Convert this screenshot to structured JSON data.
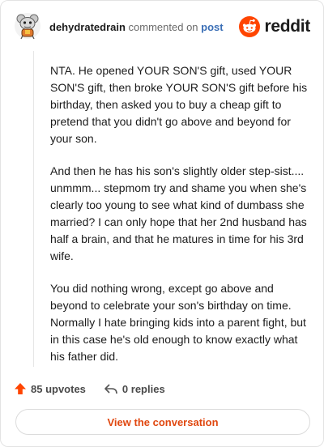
{
  "header": {
    "username": "dehydratedrain",
    "action_text": "commented on",
    "post_link": "post",
    "brand": "reddit"
  },
  "comment": {
    "paragraphs": [
      "NTA. He opened YOUR SON'S gift, used YOUR SON'S gift, then broke YOUR SON'S gift before his birthday, then asked you to buy a cheap gift to pretend that you didn't go above and beyond for your son.",
      "And then he has his son's slightly older step-sist.... unmmm... stepmom try and shame you when she's clearly too young to see what kind of dumbass she married? I can only hope that her 2nd husband has half a brain, and that he matures in time for his 3rd wife.",
      "You did nothing wrong, except go above and beyond to celebrate your son's birthday on time. Normally I hate bringing kids into a parent fight, but in this case he's old enough to know exactly what his father did."
    ]
  },
  "stats": {
    "upvotes": "85 upvotes",
    "replies": "0 replies"
  },
  "cta": {
    "label": "View the conversation"
  },
  "colors": {
    "accent": "#ff4500",
    "link": "#3b6fb6",
    "cta_text": "#e0470f"
  },
  "icons": {
    "avatar": "snoo-avatar",
    "brand": "reddit-logo-icon",
    "upvote": "upvote-arrow-icon",
    "reply": "reply-arrow-icon"
  }
}
